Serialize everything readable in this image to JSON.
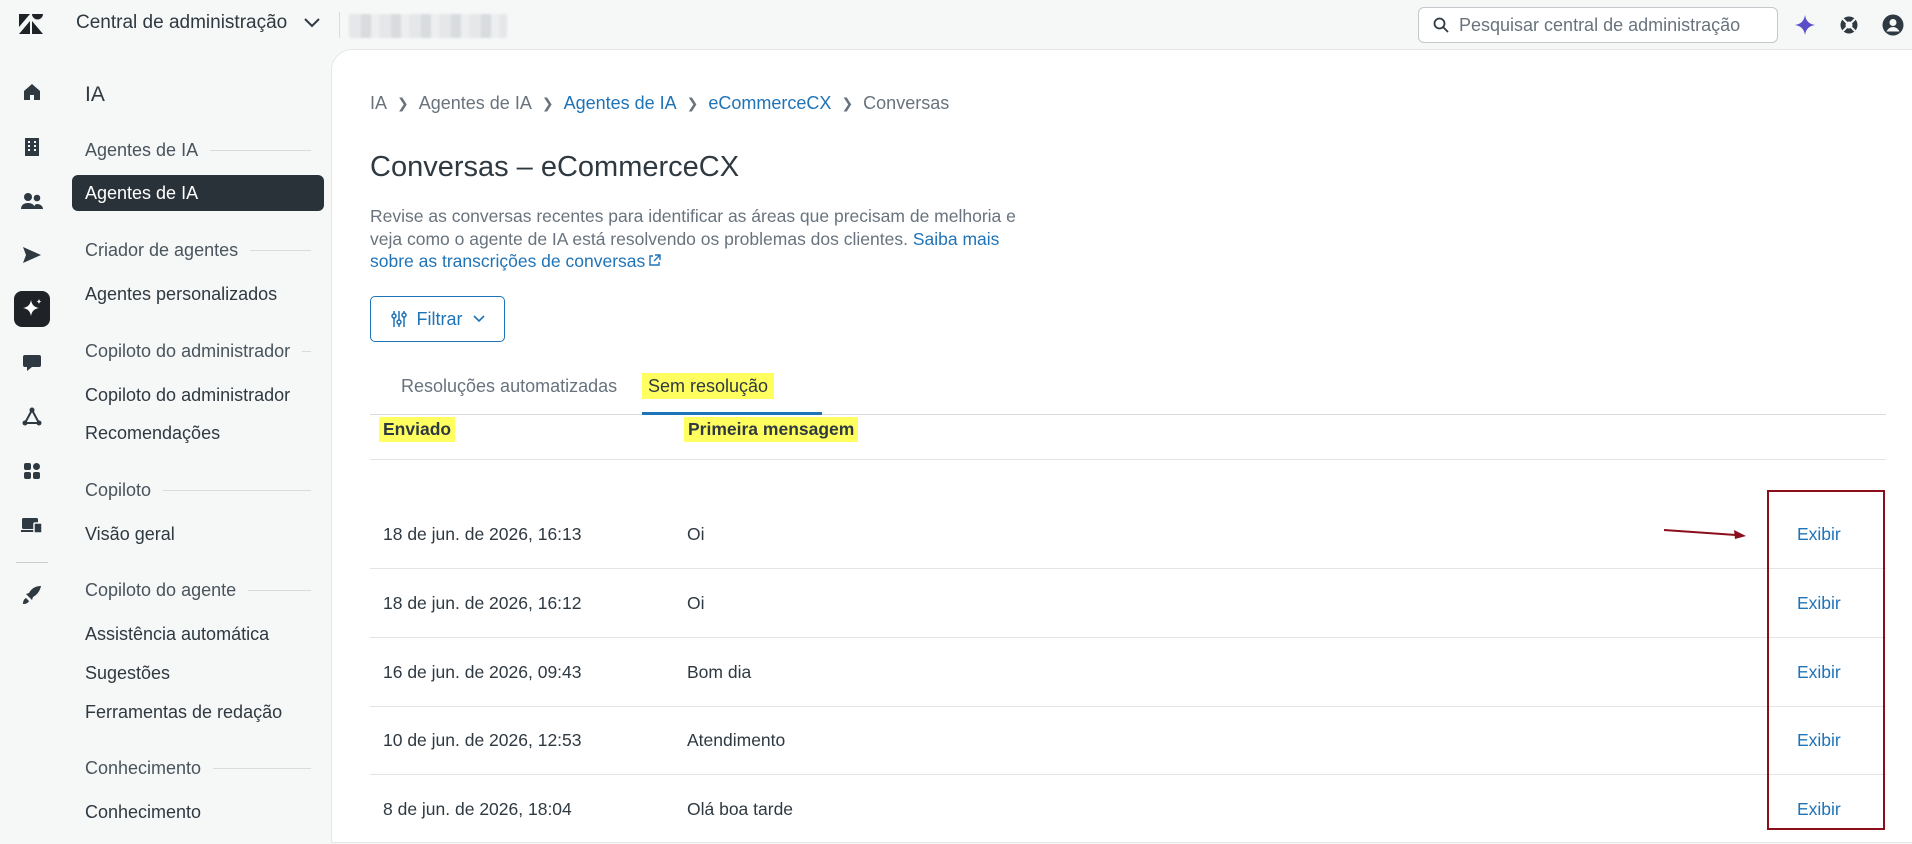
{
  "header": {
    "product_name": "Central de administração",
    "search_placeholder": "Pesquisar central de administração"
  },
  "rail": {
    "icons": [
      "home-icon",
      "building-icon",
      "people-icon",
      "send-icon",
      "sparkle-icon",
      "chat-icon",
      "triangle-nodes-icon",
      "apps-icon",
      "devices-icon",
      "rocket-icon"
    ],
    "active": "sparkle-icon"
  },
  "subnav": {
    "title": "IA",
    "sections": [
      {
        "heading": "Agentes de IA",
        "items": [
          "Agentes de IA"
        ]
      },
      {
        "heading": "Criador de agentes",
        "items": [
          "Agentes personalizados"
        ]
      },
      {
        "heading": "Copiloto do administrador",
        "items": [
          "Copiloto do administrador",
          "Recomendações"
        ]
      },
      {
        "heading": "Copiloto",
        "items": [
          "Visão geral"
        ]
      },
      {
        "heading": "Copiloto do agente",
        "items": [
          "Assistência automática",
          "Sugestões",
          "Ferramentas de redação"
        ]
      },
      {
        "heading": "Conhecimento",
        "items": [
          "Conhecimento"
        ]
      }
    ]
  },
  "breadcrumb": [
    "IA",
    "Agentes de IA",
    "Agentes de IA",
    "eCommerceCX",
    "Conversas"
  ],
  "page": {
    "title": "Conversas – eCommerceCX",
    "description": "Revise as conversas recentes para identificar as áreas que precisam de melhoria e veja como o agente de IA está resolvendo os problemas dos clientes. ",
    "description_link": "Saiba mais sobre as transcrições de conversas",
    "filter_label": "Filtrar"
  },
  "tabs": [
    "Resoluções automatizadas",
    "Sem resolução"
  ],
  "active_tab": "Sem resolução",
  "table": {
    "headers": [
      "Enviado",
      "Primeira mensagem"
    ],
    "rows": [
      {
        "sent": "18 de jun. de 2026, 16:13",
        "first_message": "Oi",
        "action": "Exibir"
      },
      {
        "sent": "18 de jun. de 2026, 16:12",
        "first_message": "Oi",
        "action": "Exibir"
      },
      {
        "sent": "16 de jun. de 2026, 09:43",
        "first_message": "Bom dia",
        "action": "Exibir"
      },
      {
        "sent": "10 de jun. de 2026, 12:53",
        "first_message": "Atendimento",
        "action": "Exibir"
      },
      {
        "sent": "8 de jun. de 2026, 18:04",
        "first_message": "Olá boa tarde",
        "action": "Exibir"
      }
    ]
  },
  "colors": {
    "accent": "#1f73b7",
    "highlight": "#ffff5f",
    "annotation": "#8b0e1a",
    "active_nav": "#293239"
  }
}
